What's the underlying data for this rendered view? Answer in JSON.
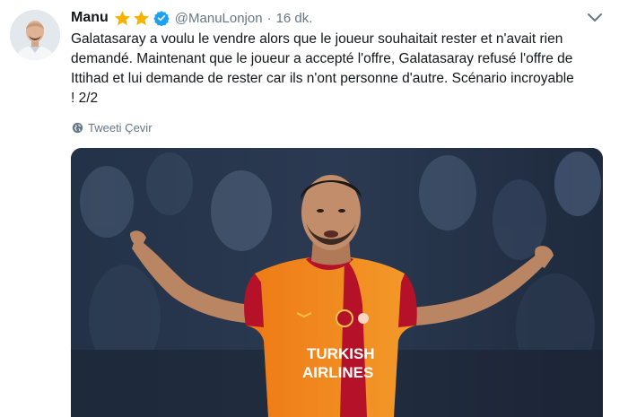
{
  "tweet": {
    "display_name": "Manu",
    "handle": "@ManuLonjon",
    "separator": "·",
    "time": "16 dk.",
    "text_lines": [
      "Galatasaray a voulu le vendre alors que le joueur souhaitait rester et n'avait rien",
      "demandé. Maintenant que le joueur a accepté l'offre, Galatasaray refusé l'offre de",
      "Ittihad et lui demande de rester car ils n'ont personne d'autre. Scénario incroyable",
      "! 2/2"
    ],
    "translate_label": "Tweeti Çevir",
    "photo_jersey_text": [
      "TURKISH",
      "AIRLINES"
    ]
  },
  "colors": {
    "star": "#f5b301",
    "verified": "#1da1f2",
    "secondary_text": "#657786",
    "jersey_orange": "#f07a12",
    "jersey_red": "#b5122a"
  },
  "icons": {
    "stars": "star-icon",
    "verified": "verified-badge-icon",
    "caret": "chevron-down-icon",
    "translate": "globe-icon"
  }
}
